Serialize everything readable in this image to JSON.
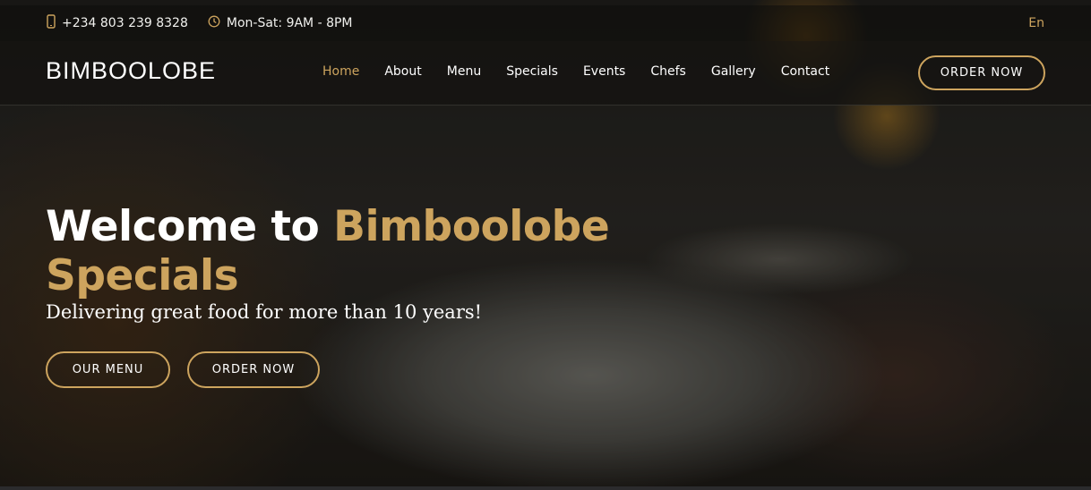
{
  "topbar": {
    "phone": "+234 803 239 8328",
    "hours": "Mon-Sat: 9AM - 8PM",
    "language": "En",
    "icons": [
      "phone-icon",
      "clock-icon"
    ]
  },
  "navbar": {
    "logo": "BIMBOOLOBE",
    "links": [
      "Home",
      "About",
      "Menu",
      "Specials",
      "Events",
      "Chefs",
      "Gallery",
      "Contact"
    ],
    "active": "Home",
    "order_button": "ORDER NOW"
  },
  "hero": {
    "title_white": "Welcome to ",
    "title_gold": "Bimboolobe Specials",
    "subtitle": "Delivering great food for more than 10 years!",
    "menu_button": "OUR MENU",
    "order_button": "ORDER NOW"
  },
  "colors": {
    "accent": "#cda45e",
    "text": "#ffffff"
  }
}
